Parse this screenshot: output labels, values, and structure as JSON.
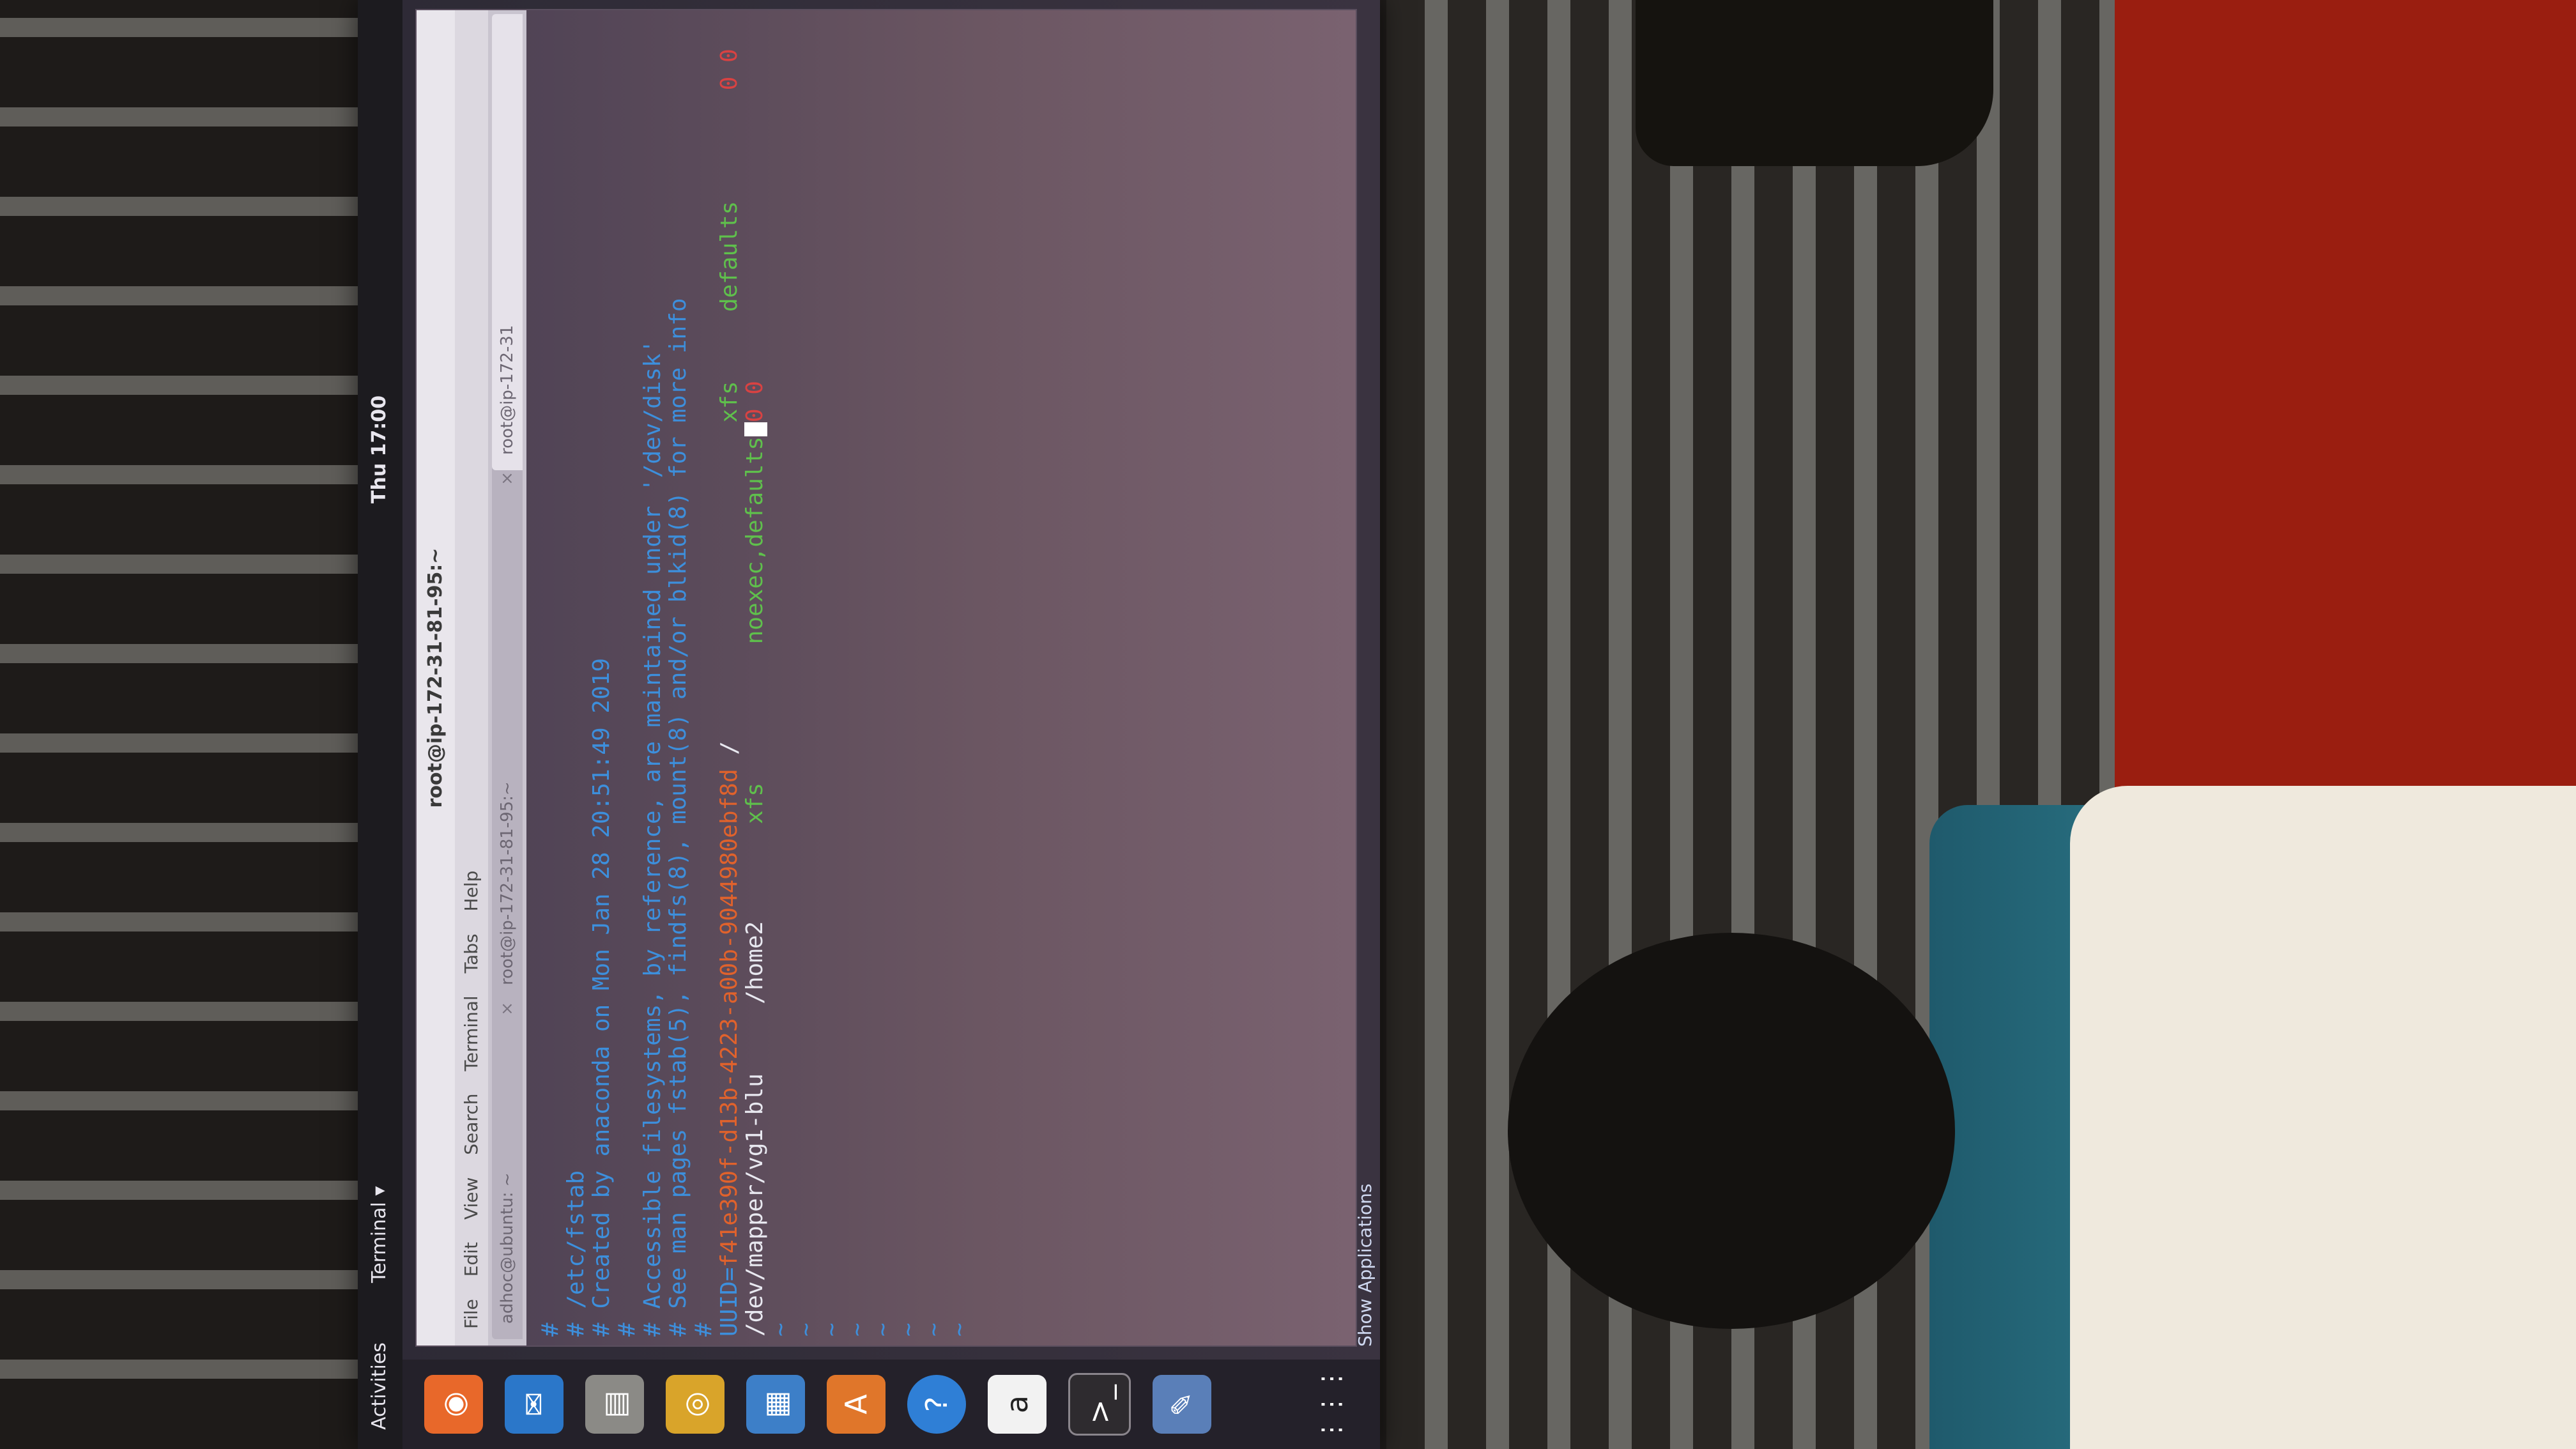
{
  "topbar": {
    "activities": "Activities",
    "app_menu": "Terminal ▾",
    "clock": "Thu 17:00"
  },
  "window": {
    "title": "root@ip-172-31-81-95:~",
    "menu": [
      "File",
      "Edit",
      "View",
      "Search",
      "Terminal",
      "Tabs",
      "Help"
    ],
    "tabs": [
      {
        "label": "adhoc@ubuntu: ~",
        "close": "×"
      },
      {
        "label": "root@ip-172-31-81-95:~",
        "close": "×"
      },
      {
        "label": "root@ip-172-31",
        "close": ""
      }
    ]
  },
  "terminal": {
    "lines": [
      {
        "prefix": "#",
        "text": "",
        "cls": "c-comment"
      },
      {
        "prefix": "#",
        "text": " /etc/fstab",
        "cls": "c-comment"
      },
      {
        "prefix": "#",
        "text": " Created by anaconda on Mon Jan 28 20:51:49 2019",
        "cls": "c-comment"
      },
      {
        "prefix": "#",
        "text": "",
        "cls": "c-comment"
      },
      {
        "prefix": "#",
        "text": " Accessible filesystems, by reference, are maintained under '/dev/disk'",
        "cls": "c-comment"
      },
      {
        "prefix": "#",
        "text": " See man pages fstab(5), findfs(8), mount(8) and/or blkid(8) for more info",
        "cls": "c-comment"
      },
      {
        "prefix": "#",
        "text": "",
        "cls": "c-comment"
      }
    ],
    "uuid_line": {
      "label": "UUID=",
      "uuid": "f41e390f-d13b-4223-a00b-9044980ebf8d",
      "mount": " /",
      "fstype": "xfs",
      "options": "defaults",
      "dump": "0 0"
    },
    "lvm_line": {
      "device": "/dev/mapper/vg1-blu",
      "mount": "/home2",
      "fstype": "xfs",
      "options": "noexec,defaults",
      "dump": "0 0"
    },
    "tilde": "~"
  },
  "dock": {
    "icons": [
      "firefox-icon",
      "thunderbird-icon",
      "files-icon",
      "rhythmbox-icon",
      "libreoffice-icon",
      "software-icon",
      "help-icon",
      "amazon-icon",
      "terminal-icon",
      "text-editor-icon"
    ],
    "show_apps": "Show Applications"
  }
}
